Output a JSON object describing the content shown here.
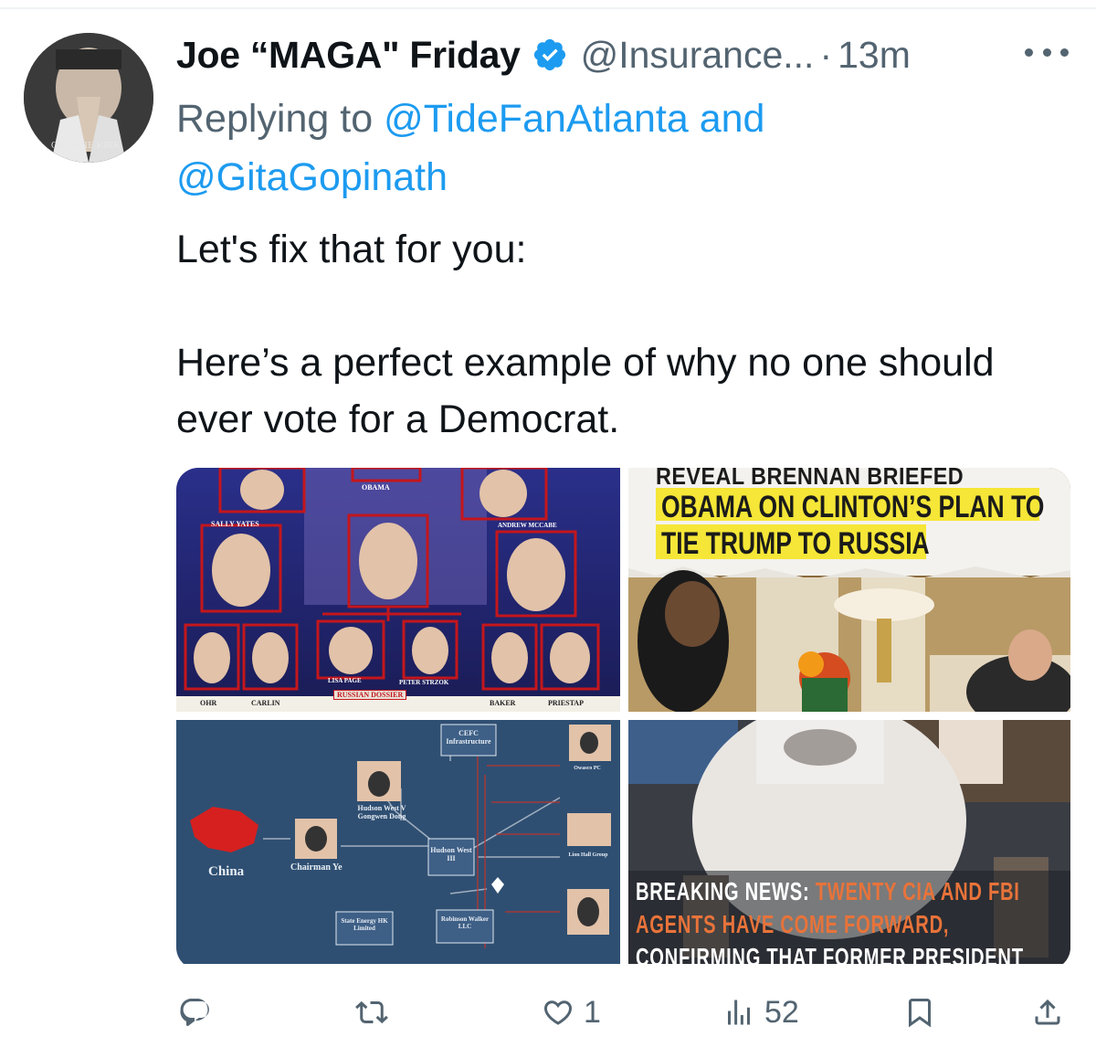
{
  "author": {
    "display_name": "Joe “MAGA\" Friday",
    "handle": "@Insurance...",
    "separator": "·",
    "time": "13m",
    "avatar_caption": "CHARLIE KIRK",
    "verified": true
  },
  "reply_to": {
    "prefix": "Replying to",
    "user1": "@TideFanAtlanta",
    "conj": "and",
    "user2": "@GitaGopinath"
  },
  "tweet": {
    "line1": "Let's fix that for you:",
    "line2": "Here’s a perfect example of why no one should ever vote for a Democrat."
  },
  "media": {
    "img1": {
      "labels": [
        "OBAMA",
        "SALLY YATES",
        "ANDREW MCCABE",
        "LISA PAGE",
        "PETER STRZOK",
        "RUSSIAN DOSSIER",
        "OHR",
        "CARLIN",
        "BAKER",
        "PRIESTAP"
      ]
    },
    "img2": {
      "headline_top": "REVEAL BRENNAN BRIEFED",
      "headline_line1": "OBAMA ON CLINTON’S PLAN TO",
      "headline_line2": "TIE TRUMP TO RUSSIA"
    },
    "img3": {
      "labels": [
        "China",
        "Chairman Ye",
        "Hudson West V Gongwen Dong",
        "Hudson West III",
        "CEFC Infrastructure",
        "State Energy HK Limited",
        "Robinson Walker LLC",
        "Owasco PC",
        "Lion Hall Group"
      ]
    },
    "img4": {
      "banner_lead": "BREAKING NEWS:",
      "banner_line1_rest": "TWENTY CIA AND FBI",
      "banner_line2": "AGENTS HAVE COME FORWARD,",
      "banner_line3": "CONFIRMING THAT FORMER PRESIDENT"
    }
  },
  "actions": {
    "reply_count": "",
    "retweet_count": "",
    "like_count": "1",
    "views_count": "52"
  },
  "colors": {
    "link": "#1d9bf0",
    "muted": "#536471",
    "verified": "#1d9bf0",
    "text": "#0f1419"
  }
}
